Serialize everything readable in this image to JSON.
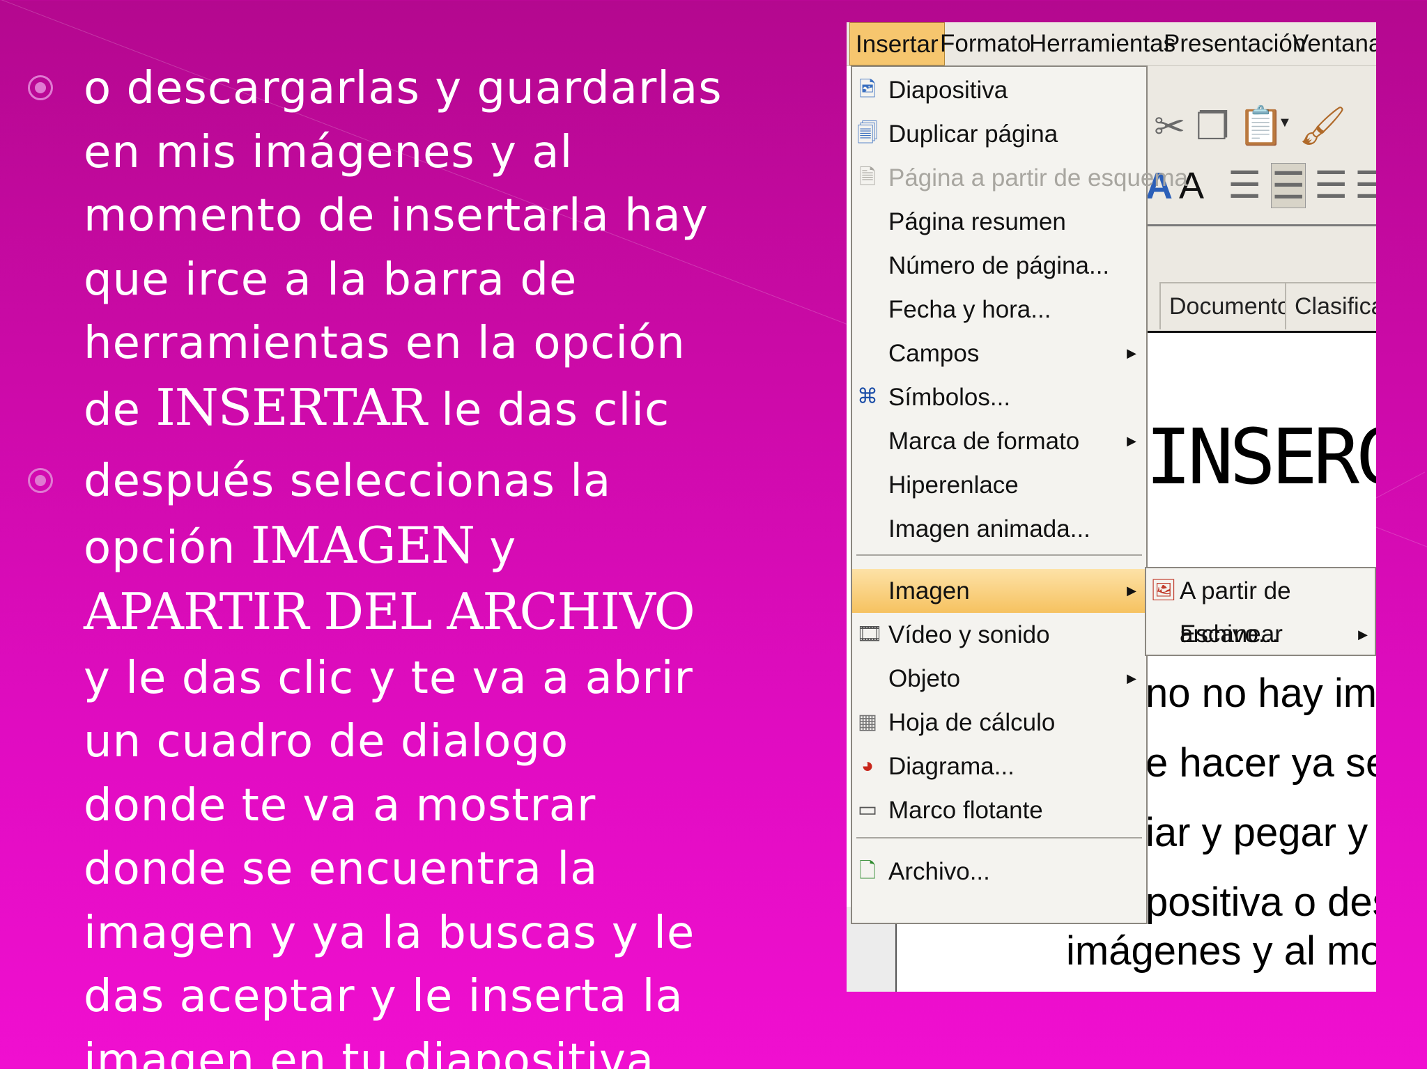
{
  "bullets": [
    {
      "lines": [
        {
          "text": "o descargarlas y guardarlas"
        },
        {
          "text": "en mis imágenes y al"
        },
        {
          "text": "momento de insertarla hay"
        },
        {
          "text": "que irce a la barra de"
        },
        {
          "text": "herramientas en la opción"
        },
        {
          "pre": "de ",
          "emph": "INSERTAR",
          "post": " le das clic"
        }
      ]
    },
    {
      "lines": [
        {
          "text": "después seleccionas la"
        },
        {
          "pre": "opción ",
          "emph": "IMAGEN",
          "post": " y"
        },
        {
          "pre": "",
          "emph": "APARTIR DEL ARCHIVO",
          "post": ""
        },
        {
          "text": "y le das clic y te va a abrir"
        },
        {
          "text": "un cuadro de dialogo"
        },
        {
          "text": "donde te va a mostrar"
        },
        {
          "text": "donde se encuentra la"
        },
        {
          "text": "imagen y ya la buscas y le"
        },
        {
          "text": "das aceptar y le inserta la"
        },
        {
          "text": "imagen en tu diapositiva"
        }
      ]
    }
  ],
  "screenshot": {
    "menubar": [
      "Insertar",
      "Formato",
      "Herramientas",
      "Presentación",
      "Ventana"
    ],
    "menu_items": [
      {
        "label": "Diapositiva",
        "icon": "slide-icon",
        "disabled": false,
        "submenu": false
      },
      {
        "label": "Duplicar página",
        "icon": "duplicate-page-icon",
        "disabled": false,
        "submenu": false
      },
      {
        "label": "Página a partir de esquema",
        "icon": "outline-page-icon",
        "disabled": true,
        "submenu": false
      },
      {
        "label": "Página resumen",
        "icon": "",
        "disabled": false,
        "submenu": false
      },
      {
        "label": "Número de página...",
        "icon": "",
        "disabled": false,
        "submenu": false
      },
      {
        "label": "Fecha y hora...",
        "icon": "",
        "disabled": false,
        "submenu": false
      },
      {
        "label": "Campos",
        "icon": "",
        "disabled": false,
        "submenu": true
      },
      {
        "label": "Símbolos...",
        "icon": "symbols-icon",
        "disabled": false,
        "submenu": false
      },
      {
        "label": "Marca de formato",
        "icon": "",
        "disabled": false,
        "submenu": true
      },
      {
        "label": "Hiperenlace",
        "icon": "",
        "disabled": false,
        "submenu": false
      },
      {
        "label": "Imagen animada...",
        "icon": "",
        "disabled": false,
        "submenu": false
      },
      {
        "label": "Imagen",
        "icon": "",
        "disabled": false,
        "submenu": true,
        "highlighted": true
      },
      {
        "label": "Vídeo y sonido",
        "icon": "video-icon",
        "disabled": false,
        "submenu": false
      },
      {
        "label": "Objeto",
        "icon": "",
        "disabled": false,
        "submenu": true
      },
      {
        "label": "Hoja de cálculo",
        "icon": "spreadsheet-icon",
        "disabled": false,
        "submenu": false
      },
      {
        "label": "Diagrama...",
        "icon": "chart-icon",
        "disabled": false,
        "submenu": false
      },
      {
        "label": "Marco flotante",
        "icon": "frame-icon",
        "disabled": false,
        "submenu": false
      },
      {
        "label": "Archivo...",
        "icon": "file-icon",
        "disabled": false,
        "submenu": false
      }
    ],
    "submenu": [
      {
        "label": "A partir de archivo...",
        "icon": "image-file-icon",
        "submenu": false
      },
      {
        "label": "Escanear",
        "icon": "",
        "submenu": true
      }
    ],
    "tabs": [
      "Documento",
      "Clasificac"
    ],
    "document_text": [
      "INSERCIÓ",
      "no no hay imáge",
      "e hacer ya sea l",
      "iar y pegar y as",
      "positiva o desca",
      "imágenes y al mome"
    ]
  }
}
